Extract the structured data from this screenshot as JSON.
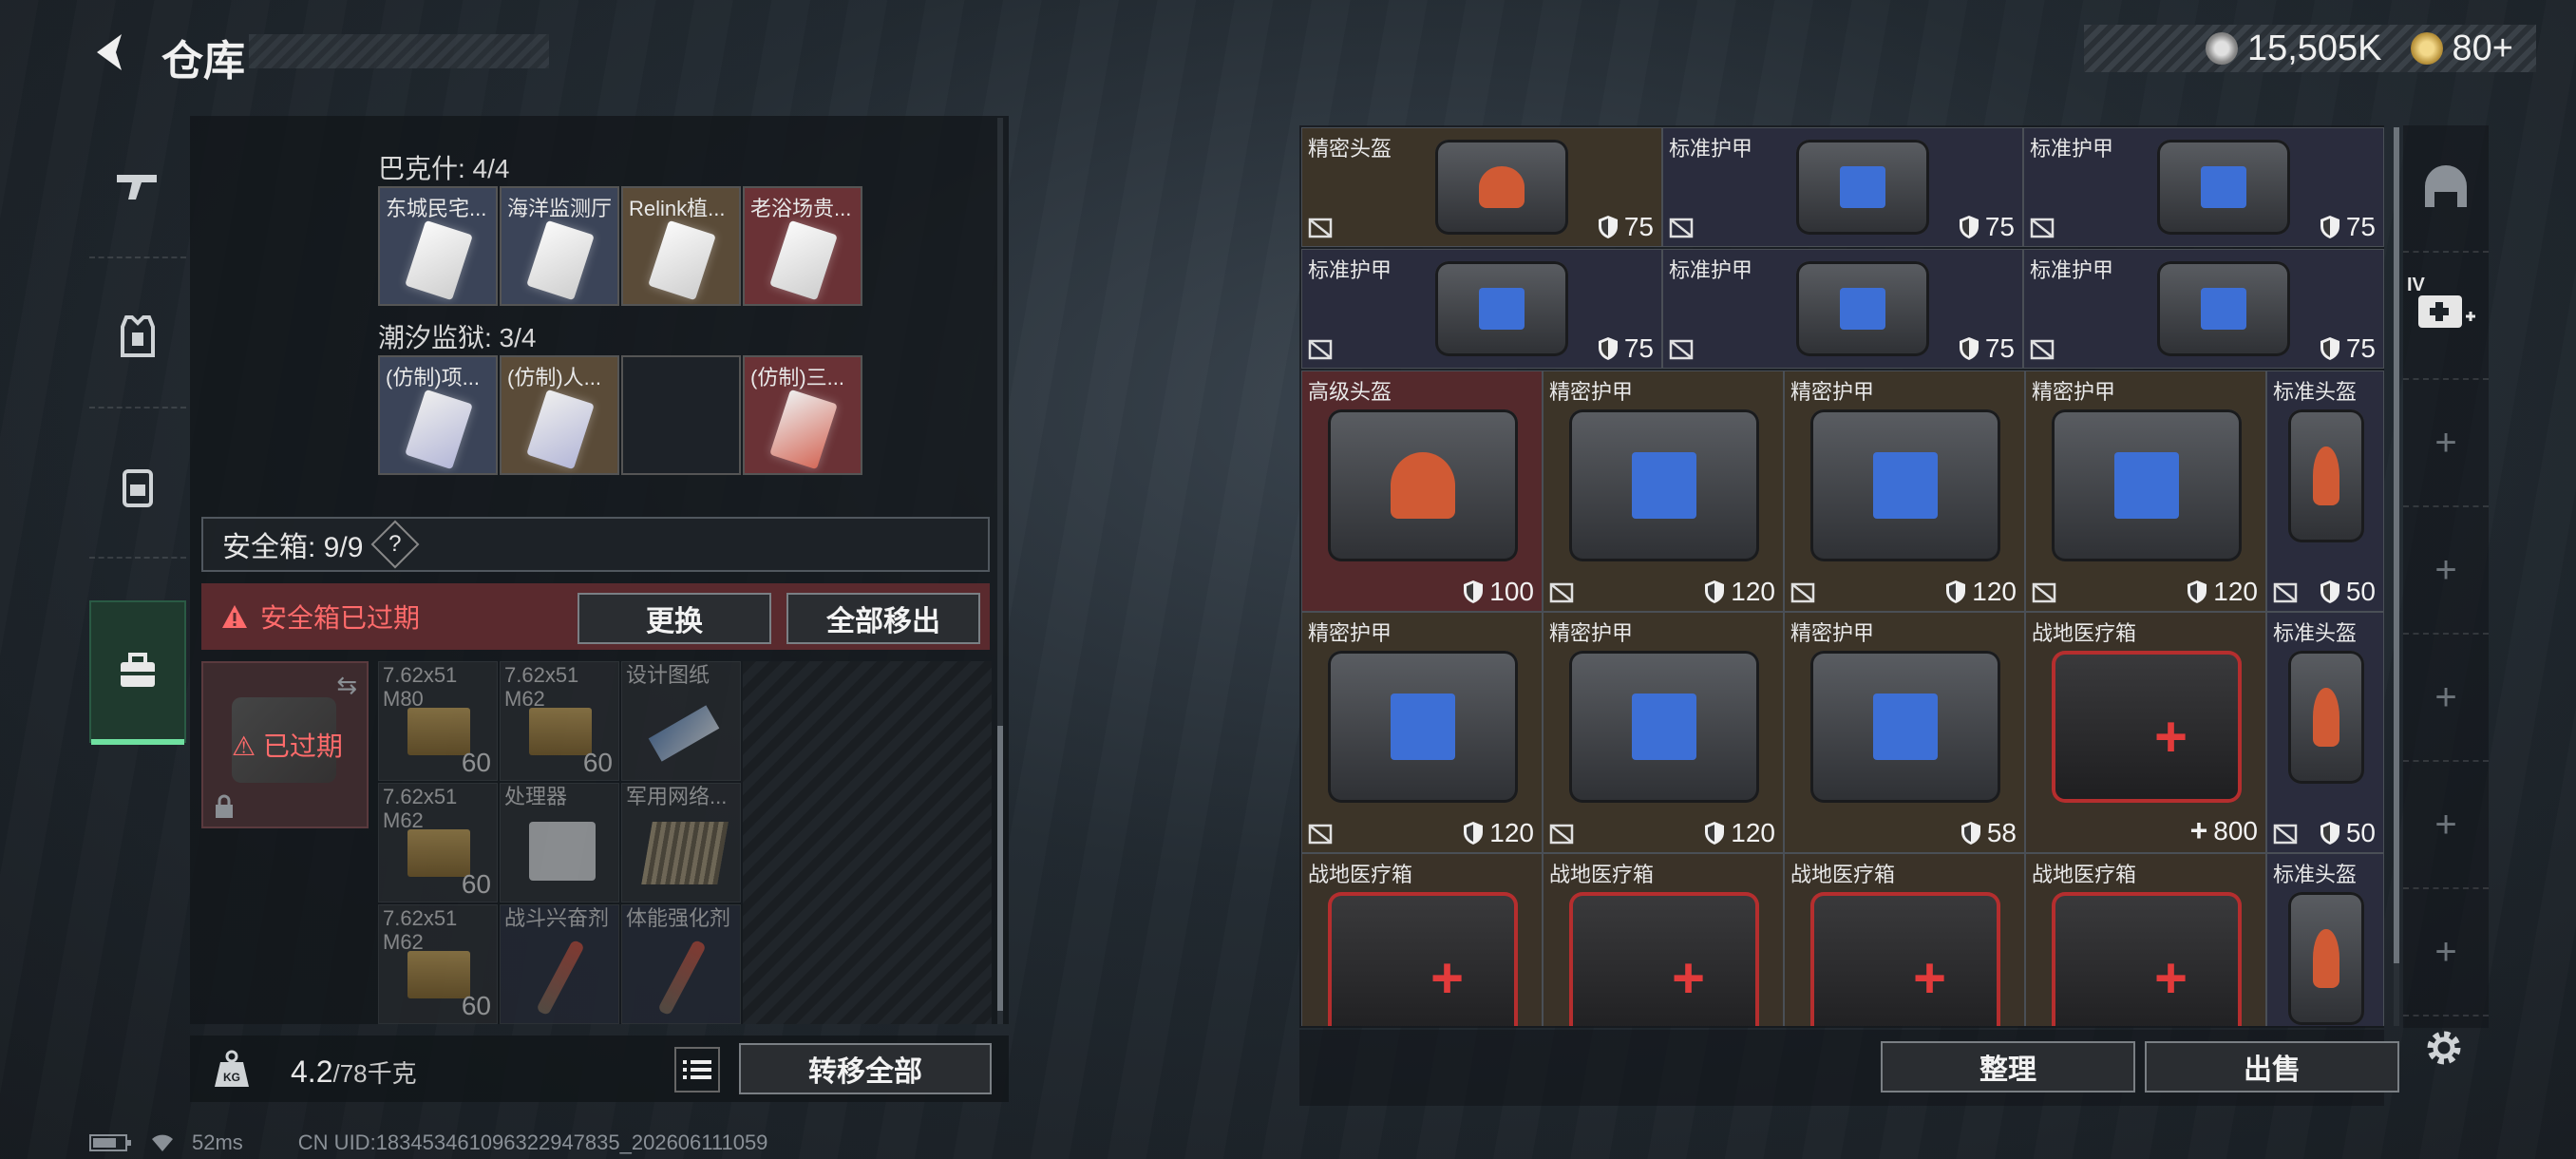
{
  "header": {
    "title": "仓库",
    "currency1": "15,505K",
    "currency2": "80+"
  },
  "left_sidebar": [
    {
      "icon": "gun-icon"
    },
    {
      "icon": "armor-vest-icon"
    },
    {
      "icon": "backpack-icon"
    },
    {
      "icon": "toolbox-icon",
      "active": true
    }
  ],
  "collections": [
    {
      "label": "巴克什: 4/4",
      "items": [
        {
          "name": "东城民宅...",
          "color": "blue"
        },
        {
          "name": "海洋监测厅",
          "color": "blue"
        },
        {
          "name": "Relink植...",
          "color": "gold"
        },
        {
          "name": "老浴场贵...",
          "color": "red"
        }
      ]
    },
    {
      "label": "潮汐监狱: 3/4",
      "items": [
        {
          "name": "(仿制)项...",
          "color": "blue"
        },
        {
          "name": "(仿制)人...",
          "color": "gold"
        },
        {
          "name": "",
          "color": "empty"
        },
        {
          "name": "(仿制)三...",
          "color": "red"
        }
      ]
    }
  ],
  "safebox": {
    "label": "安全箱: 9/9",
    "help": "?",
    "warning": "安全箱已过期",
    "replace_btn": "更换",
    "remove_all_btn": "全部移出",
    "expired_label": "已过期",
    "items": [
      {
        "name": "7.62x51",
        "name2": "M80",
        "count": "60"
      },
      {
        "name": "7.62x51",
        "name2": "M62",
        "count": "60"
      },
      {
        "name": "设计图纸",
        "name2": "",
        "count": ""
      },
      {
        "name": "7.62x51",
        "name2": "M62",
        "count": "60"
      },
      {
        "name": "处理器",
        "name2": "",
        "count": ""
      },
      {
        "name": "军用网络...",
        "name2": "",
        "count": ""
      },
      {
        "name": "7.62x51",
        "name2": "M62",
        "count": "60"
      },
      {
        "name": "战斗兴奋剂",
        "name2": "",
        "count": ""
      },
      {
        "name": "体能强化剂",
        "name2": "",
        "count": ""
      }
    ]
  },
  "bottom_left": {
    "weight": "4.2",
    "weight_max": "/78千克",
    "transfer_all": "转移全部"
  },
  "status": {
    "ping": "52ms",
    "uid": "CN UID:18345346109632294783​5_202606111059"
  },
  "stash_items": [
    {
      "name": "精密头盔",
      "val": "75",
      "type": "helm",
      "bg": "prec"
    },
    {
      "name": "标准护甲",
      "val": "75",
      "type": "vest",
      "bg": "std"
    },
    {
      "name": "标准护甲",
      "val": "75",
      "type": "vest",
      "bg": "std"
    },
    {
      "name": "标准护甲",
      "val": "75",
      "type": "vest",
      "bg": "std"
    },
    {
      "name": "标准护甲",
      "val": "75",
      "type": "vest",
      "bg": "std"
    },
    {
      "name": "标准护甲",
      "val": "75",
      "type": "vest",
      "bg": "std"
    },
    {
      "name": "高级头盔",
      "val": "100",
      "type": "helm",
      "bg": "high"
    },
    {
      "name": "精密护甲",
      "val": "120",
      "type": "vest",
      "bg": "prec"
    },
    {
      "name": "精密护甲",
      "val": "120",
      "type": "vest",
      "bg": "prec"
    },
    {
      "name": "精密护甲",
      "val": "120",
      "type": "vest",
      "bg": "prec"
    },
    {
      "name": "标准头盔",
      "val": "50",
      "type": "helm",
      "bg": "std"
    },
    {
      "name": "精密护甲",
      "val": "120",
      "type": "vest",
      "bg": "prec"
    },
    {
      "name": "精密护甲",
      "val": "120",
      "type": "vest",
      "bg": "prec"
    },
    {
      "name": "精密护甲",
      "val": "58",
      "type": "vest",
      "bg": "prec"
    },
    {
      "name": "战地医疗箱",
      "val": "800",
      "type": "med",
      "bg": "med"
    },
    {
      "name": "标准头盔",
      "val": "50",
      "type": "helm",
      "bg": "std"
    },
    {
      "name": "战地医疗箱",
      "val": "",
      "type": "med",
      "bg": "med"
    },
    {
      "name": "战地医疗箱",
      "val": "",
      "type": "med",
      "bg": "med"
    },
    {
      "name": "战地医疗箱",
      "val": "",
      "type": "med",
      "bg": "med"
    },
    {
      "name": "战地医疗箱",
      "val": "",
      "type": "med",
      "bg": "med"
    },
    {
      "name": "标准头盔",
      "val": "",
      "type": "helm",
      "bg": "std"
    }
  ],
  "right_sidebar": [
    {
      "icon": "helmet-icon"
    },
    {
      "icon": "medkit-plus-icon",
      "badge": "IV"
    },
    {
      "icon": "plus-icon"
    },
    {
      "icon": "plus-icon"
    },
    {
      "icon": "plus-icon"
    },
    {
      "icon": "plus-icon"
    },
    {
      "icon": "plus-icon"
    }
  ],
  "bottom_right": {
    "sort_btn": "整理",
    "sell_btn": "出售"
  }
}
